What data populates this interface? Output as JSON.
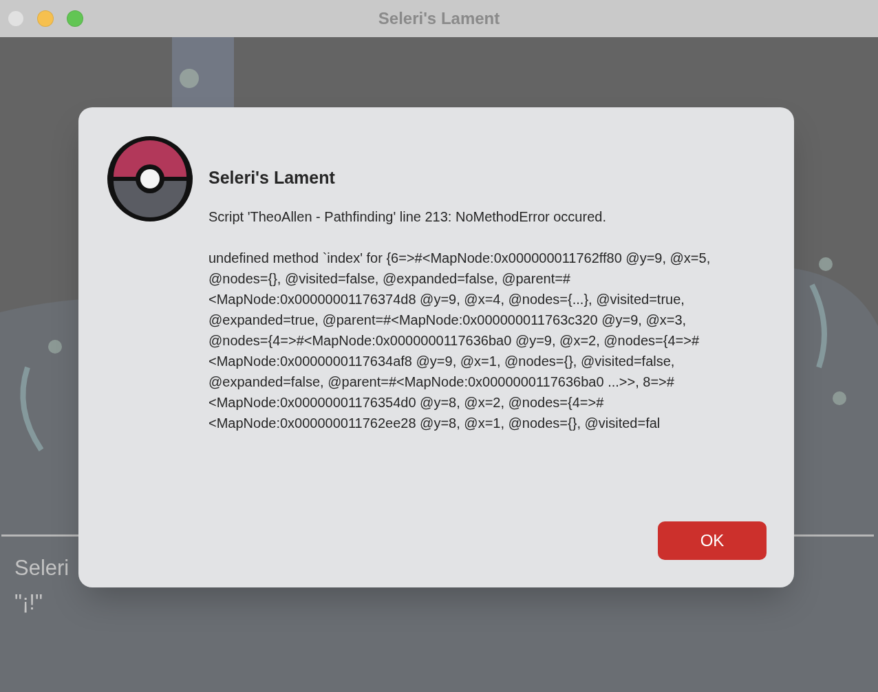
{
  "window": {
    "title": "Seleri's Lament",
    "controls": [
      {
        "color": "#e1e1e1"
      },
      {
        "color": "#f6c04f"
      },
      {
        "color": "#62c554"
      }
    ]
  },
  "game": {
    "message": {
      "speaker": "Seleri",
      "text": "\"¡!\""
    }
  },
  "alert": {
    "title": "Seleri's Lament",
    "message": "Script 'TheoAllen - Pathfinding' line 213: NoMethodError occured.",
    "details": "undefined method `index' for {6=>#<MapNode:0x000000011762ff80 @y=9, @x=5, @nodes={}, @visited=false, @expanded=false, @parent=#<MapNode:0x00000001176374d8 @y=9, @x=4, @nodes={...}, @visited=true, @expanded=true, @parent=#<MapNode:0x000000011763c320 @y=9, @x=3, @nodes={4=>#<MapNode:0x0000000117636ba0 @y=9, @x=2, @nodes={4=>#<MapNode:0x0000000117634af8 @y=9, @x=1, @nodes={}, @visited=false, @expanded=false, @parent=#<MapNode:0x0000000117636ba0 ...>>, 8=>#<MapNode:0x00000001176354d0 @y=8, @x=2, @nodes={4=>#<MapNode:0x000000011762ee28 @y=8, @x=1, @nodes={}, @visited=fal",
    "button": "OK"
  }
}
